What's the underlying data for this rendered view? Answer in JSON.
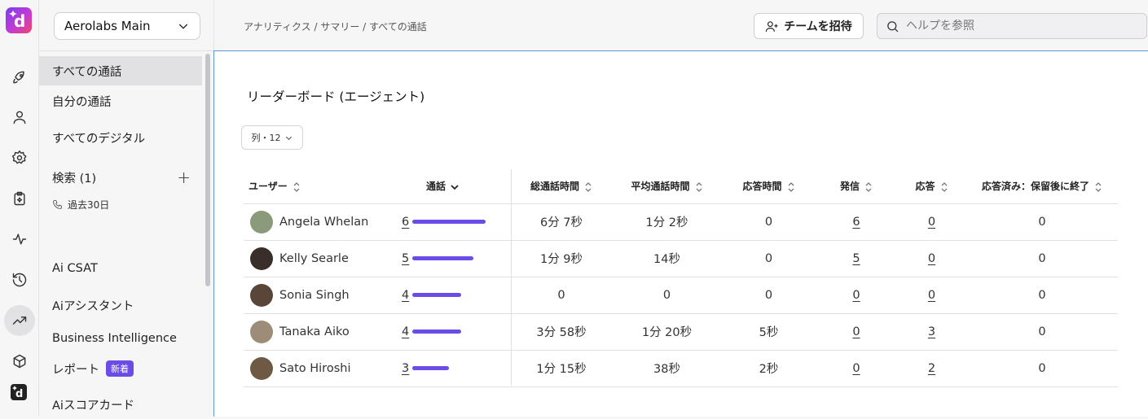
{
  "sidebar": {
    "workspace": "Aerolabs Main",
    "items": [
      {
        "label": "すべての通話"
      },
      {
        "label": "自分の通話"
      },
      {
        "label": "すべてのデジタル"
      }
    ],
    "search_label": "検索 (1)",
    "search_sub": "過去30日",
    "lower_items": [
      {
        "label": "Ai CSAT"
      },
      {
        "label": "Aiアシスタント"
      },
      {
        "label": "Business Intelligence"
      },
      {
        "label": "レポート",
        "badge": "新着"
      },
      {
        "label": "Aiスコアカード"
      }
    ]
  },
  "header": {
    "breadcrumb": "アナリティクス / サマリー / すべての通話",
    "invite_label": "チームを招待",
    "search_placeholder": "ヘルプを参照"
  },
  "panel": {
    "title": "リーダーボード (エージェント)",
    "columns_button": "列・12",
    "headers": [
      "ユーザー",
      "通話",
      "総通話時間",
      "平均通話時間",
      "応答時間",
      "発信",
      "応答",
      "応答済み：保留後に終了"
    ],
    "rows": [
      {
        "name": "Angela Whelan",
        "calls": "6",
        "calls_value": 6,
        "total": "6分 7秒",
        "avg": "1分 2秒",
        "resp": "0",
        "out": "6",
        "ans": "0",
        "hold": "0",
        "avatar_color": "#8a9a7a"
      },
      {
        "name": "Kelly Searle",
        "calls": "5",
        "calls_value": 5,
        "total": "1分 9秒",
        "avg": "14秒",
        "resp": "0",
        "out": "5",
        "ans": "0",
        "hold": "0",
        "avatar_color": "#3a2e2a"
      },
      {
        "name": "Sonia Singh",
        "calls": "4",
        "calls_value": 4,
        "total": "0",
        "avg": "0",
        "resp": "0",
        "out": "0",
        "ans": "0",
        "hold": "0",
        "avatar_color": "#5a4638"
      },
      {
        "name": "Tanaka Aiko",
        "calls": "4",
        "calls_value": 4,
        "total": "3分 58秒",
        "avg": "1分 20秒",
        "resp": "5秒",
        "out": "0",
        "ans": "3",
        "hold": "0",
        "avatar_color": "#9c8c78"
      },
      {
        "name": "Sato Hiroshi",
        "calls": "3",
        "calls_value": 3,
        "total": "1分 15秒",
        "avg": "38秒",
        "resp": "2秒",
        "out": "0",
        "ans": "2",
        "hold": "0",
        "avatar_color": "#6e5a44"
      }
    ]
  },
  "colors": {
    "accent": "#6b4ce6",
    "focus_border": "#5b9bd5"
  }
}
